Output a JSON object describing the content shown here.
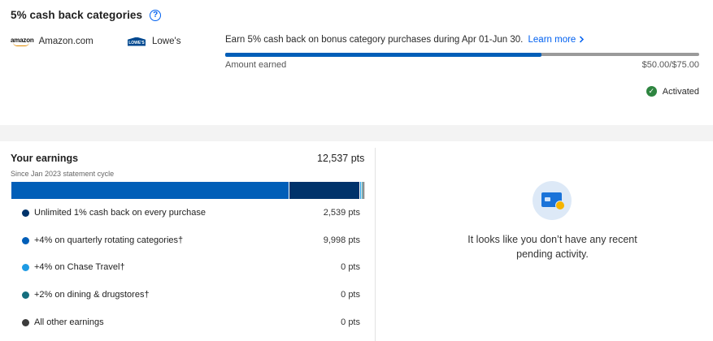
{
  "cashback": {
    "title": "5% cash back categories",
    "help_icon": "question-circle-icon",
    "merchants": [
      {
        "logo_text": "amazon",
        "name": "Amazon.com"
      },
      {
        "logo_text": "LOWE'S",
        "name": "Lowe's"
      }
    ],
    "promo_text": "Earn 5% cash back on bonus category purchases during Apr 01-Jun 30.",
    "promo_link": "Learn more",
    "amount_label": "Amount earned",
    "amount_value": "$50.00/$75.00",
    "progress_fraction": 0.6667,
    "status": "Activated",
    "colors": {
      "progress": "#005eb8",
      "track": "#9a9a9a",
      "activated": "#2e8540",
      "link": "#0060f0"
    }
  },
  "earnings": {
    "title": "Your earnings",
    "total": "12,537 pts",
    "subtitle": "Since Jan 2023 statement cycle",
    "categories": [
      {
        "label": "Unlimited 1% cash back on every purchase",
        "value": "2,539 pts",
        "points": 2539,
        "color": "#00336b"
      },
      {
        "label": "+4% on quarterly rotating categories†",
        "value": "9,998 pts",
        "points": 9998,
        "color": "#005eb8"
      },
      {
        "label": "+4% on Chase Travel†",
        "value": "0 pts",
        "points": 0,
        "color": "#1e9be4"
      },
      {
        "label": "+2% on dining & drugstores†",
        "value": "0 pts",
        "points": 0,
        "color": "#146e7e"
      },
      {
        "label": "All other earnings",
        "value": "0 pts",
        "points": 0,
        "color": "#3c3c3c"
      }
    ]
  },
  "pending": {
    "icon": "credit-card-icon",
    "message": "It looks like you don’t have any recent pending activity."
  }
}
